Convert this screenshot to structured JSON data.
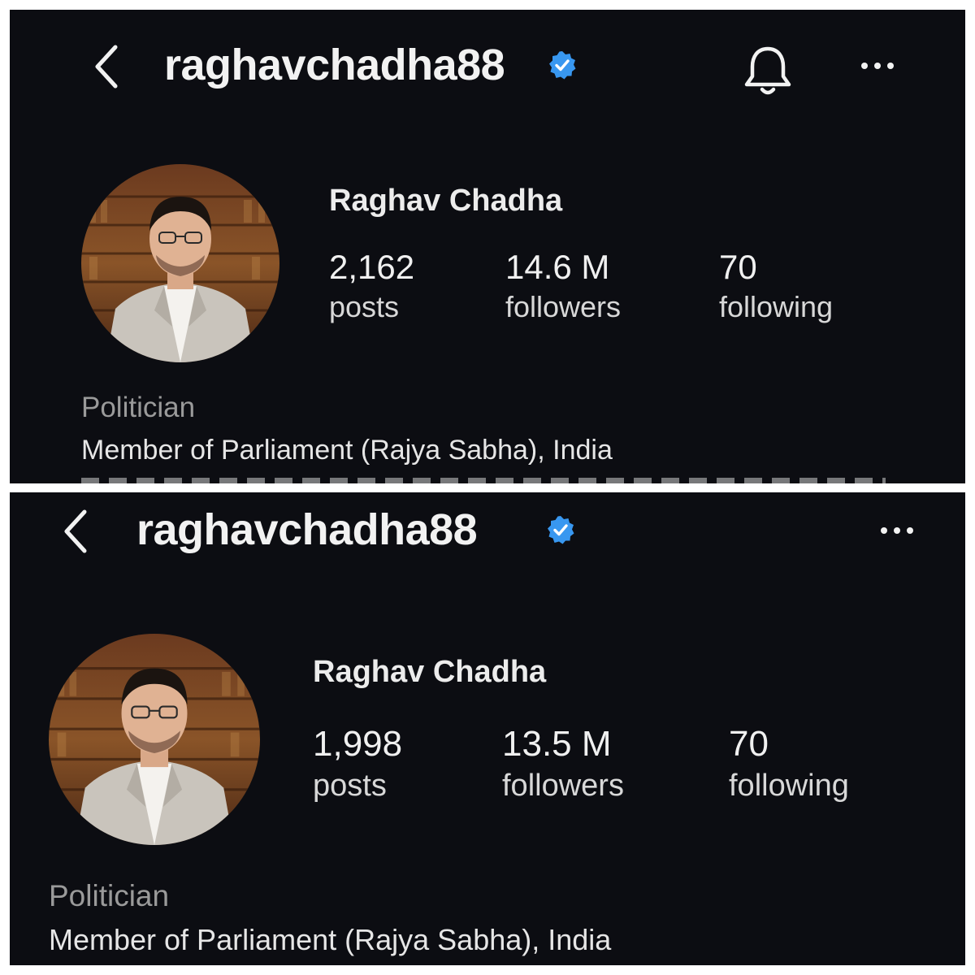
{
  "colors": {
    "background": "#0c0d12",
    "verified": "#3897f0",
    "text": "#f2f2f2",
    "muted": "#9a9a9a"
  },
  "profiles": [
    {
      "username": "raghavchadha88",
      "display_name": "Raghav Chadha",
      "posts_count": "2,162",
      "posts_label": "posts",
      "followers_count": "14.6 M",
      "followers_label": "followers",
      "following_count": "70",
      "following_label": "following",
      "category": "Politician",
      "bio_line_1": "Member of Parliament (Rajya Sabha), India",
      "icons": [
        "back-icon",
        "verified-badge-icon",
        "bell-icon",
        "more-options-icon"
      ]
    },
    {
      "username": "raghavchadha88",
      "display_name": "Raghav Chadha",
      "posts_count": "1,998",
      "posts_label": "posts",
      "followers_count": "13.5 M",
      "followers_label": "followers",
      "following_count": "70",
      "following_label": "following",
      "category": "Politician",
      "bio_line_1": "Member of Parliament (Rajya Sabha), India",
      "icons": [
        "back-icon",
        "verified-badge-icon",
        "more-options-icon"
      ]
    }
  ]
}
